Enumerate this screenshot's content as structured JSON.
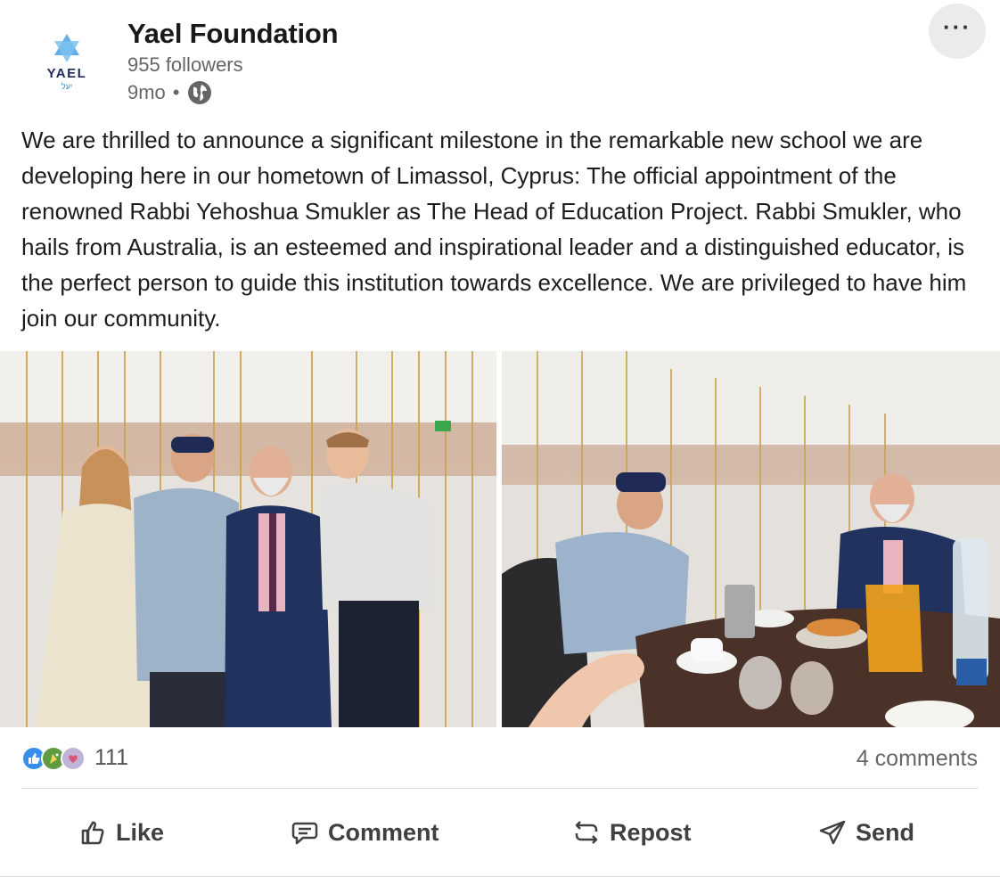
{
  "post": {
    "author": {
      "name": "Yael Foundation",
      "followers": "955 followers",
      "age": "9mo",
      "separator": "•",
      "logo_text": "YAEL",
      "logo_hebrew": "יעל",
      "visibility_icon": "globe-icon"
    },
    "menu_icon": "more-horizontal-icon",
    "menu_label": "···",
    "text": "We are thrilled to announce a significant milestone in the remarkable new school we are developing here in our hometown of Limassol, Cyprus: The official appointment of the renowned Rabbi Yehoshua Smukler as The Head of Education Project. Rabbi Smukler, who hails from Australia, is an esteemed and inspirational leader and a distinguished educator, is the perfect person to guide this institution towards excellence. We are privileged to have him join our community.",
    "photos": [
      {
        "name": "group-photo",
        "icon": "photo"
      },
      {
        "name": "breakfast-meeting-photo",
        "icon": "photo"
      }
    ],
    "social": {
      "reaction_icons": [
        "like-reaction-icon",
        "celebrate-reaction-icon",
        "support-reaction-icon"
      ],
      "reactions_count": "111",
      "comments_count": "4 comments"
    },
    "actions": [
      {
        "label": "Like",
        "icon": "thumbs-up-icon"
      },
      {
        "label": "Comment",
        "icon": "comment-icon"
      },
      {
        "label": "Repost",
        "icon": "repost-icon"
      },
      {
        "label": "Send",
        "icon": "send-icon"
      }
    ]
  },
  "colors": {
    "text_primary": "#191919",
    "text_secondary": "#666666",
    "like_blue": "#378fe9",
    "celebrate_green": "#5f9b41",
    "support_purple": "#c0b4d6",
    "logo_navy": "#1e2a5a",
    "logo_blue": "#2f8fd0"
  }
}
